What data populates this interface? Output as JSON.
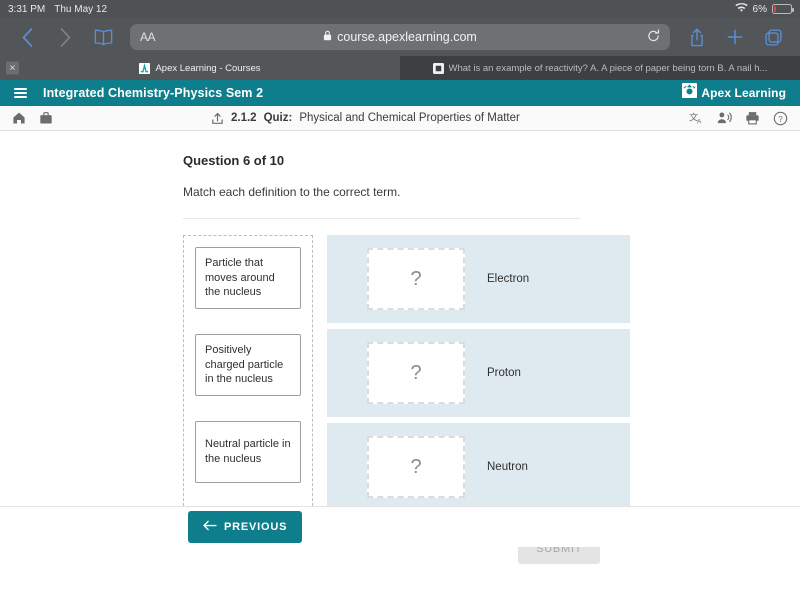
{
  "status_bar": {
    "time": "3:31 PM",
    "date": "Thu May 12",
    "battery_percent": "6%",
    "wifi_icon": "wifi-icon",
    "battery_icon": "battery-icon"
  },
  "browser": {
    "back_icon": "chevron-left-icon",
    "forward_icon": "chevron-right-icon",
    "bookmarks_icon": "book-icon",
    "text_size_label": "AA",
    "lock_icon": "lock-icon",
    "url": "course.apexlearning.com",
    "reload_icon": "reload-icon",
    "share_icon": "share-icon",
    "new_tab_icon": "plus-icon",
    "tabs_icon": "tabs-icon",
    "tabs": [
      {
        "title": "Apex Learning - Courses",
        "active": true,
        "close_icon": "close-icon",
        "favicon": "apex-favicon"
      },
      {
        "title": "What is an example of reactivity? A. A piece of paper being torn B. A nail h...",
        "active": false,
        "favicon": "generic-favicon"
      }
    ]
  },
  "apex_header": {
    "menu_icon": "hamburger-menu-icon",
    "course_title": "Integrated Chemistry-Physics Sem 2",
    "brand_name": "Apex Learning",
    "brand_icon": "apex-logo-icon",
    "accent_color": "#0f7e8c"
  },
  "toolbar": {
    "home_icon": "home-icon",
    "briefcase_icon": "briefcase-icon",
    "up_level_icon": "up-arrow-icon",
    "lesson_number": "2.1.2",
    "activity_type": "Quiz:",
    "activity_title": "Physical and Chemical Properties of Matter",
    "translate_icon": "translate-icon",
    "read-aloud_icon": "read-aloud-icon",
    "print_icon": "print-icon",
    "help_icon": "help-icon"
  },
  "question": {
    "heading": "Question 6 of 10",
    "prompt": "Match each definition to the correct term.",
    "definitions": [
      "Particle that moves around the nucleus",
      "Positively charged particle in the nucleus",
      "Neutral particle in the nucleus"
    ],
    "answers": [
      {
        "slot_placeholder": "?",
        "term": "Electron"
      },
      {
        "slot_placeholder": "?",
        "term": "Proton"
      },
      {
        "slot_placeholder": "?",
        "term": "Neutron"
      }
    ],
    "drop_zone_color": "#dfeaf0"
  },
  "actions": {
    "submit_label": "SUBMIT",
    "submit_enabled": false,
    "previous_label": "PREVIOUS",
    "previous_icon": "arrow-left-icon"
  }
}
